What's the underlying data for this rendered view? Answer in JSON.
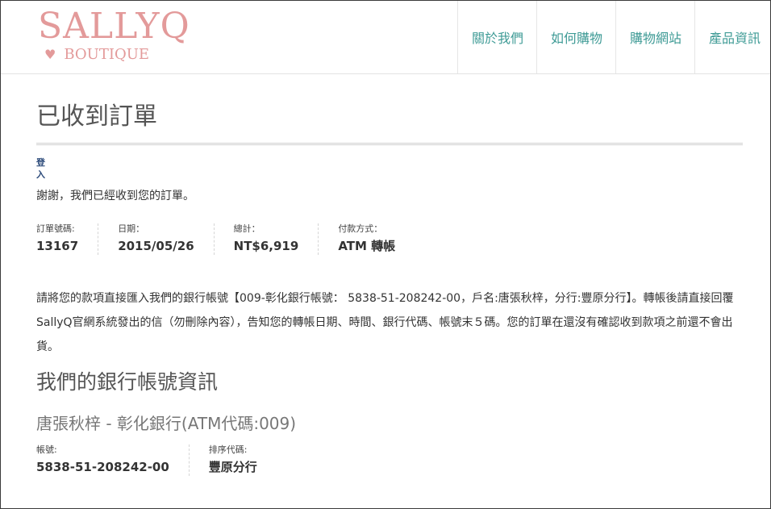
{
  "header": {
    "logo_main": "SALLYQ",
    "logo_heart": "♥",
    "logo_sub": "BOUTIQUE",
    "nav": [
      "關於我們",
      "如何購物",
      "購物網站",
      "產品資訊"
    ]
  },
  "page": {
    "title": "已收到訂單",
    "login_link": "登入",
    "thanks": "謝謝，我們已經收到您的訂單。"
  },
  "order": {
    "number_label": "訂單號碼:",
    "number": "13167",
    "date_label": "日期：",
    "date": "2015/05/26",
    "total_label": "總計：",
    "total": "NT$6,919",
    "payment_label": "付款方式：",
    "payment": "ATM 轉帳"
  },
  "instruction": "請將您的款項直接匯入我們的銀行帳號【009-彰化銀行帳號： 5838-51-208242-00，戶名:唐張秋梓，分行:豐原分行】。轉帳後請直接回覆SallyQ官網系統發出的信（勿刪除內容），告知您的轉帳日期、時間、銀行代碼、帳號末５碼。您的訂單在還沒有確認收到款項之前還不會出貨。",
  "bank": {
    "heading": "我們的銀行帳號資訊",
    "account_title": "唐張秋梓 - 彰化銀行(ATM代碼:009)",
    "account_label": "帳號:",
    "account_number": "5838-51-208242-00",
    "sort_label": "排序代碼:",
    "sort_code": "豐原分行"
  },
  "colors": {
    "logo": "#e39a9a",
    "nav_text": "#3f9b96",
    "login_link": "#2c4a7a"
  }
}
